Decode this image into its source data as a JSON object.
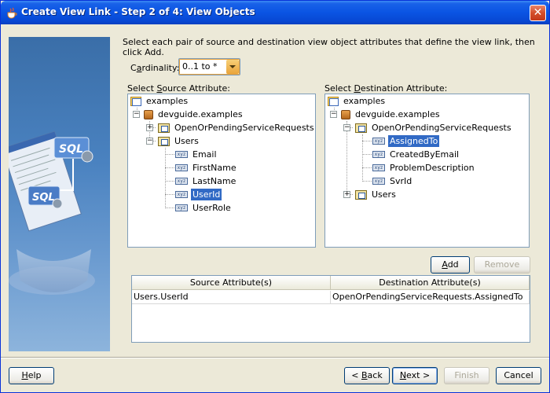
{
  "window": {
    "title": "Create View Link - Step 2 of 4: View Objects",
    "close_glyph": "✕"
  },
  "instructions": "Select each pair of source and destination view object attributes that define the view link, then click Add.",
  "cardinality": {
    "label_pre": "C",
    "label_u": "a",
    "label_post": "rdinality:",
    "value": "0..1 to *"
  },
  "source": {
    "label_pre": "Select ",
    "label_u": "S",
    "label_post": "ource Attribute:",
    "nodes": [
      "examples",
      "devguide.examples",
      "OpenOrPendingServiceRequests",
      "Users",
      "Email",
      "FirstName",
      "LastName",
      "UserId",
      "UserRole"
    ]
  },
  "destination": {
    "label_pre": "Select ",
    "label_u": "D",
    "label_post": "estination Attribute:",
    "nodes": [
      "examples",
      "devguide.examples",
      "OpenOrPendingServiceRequests",
      "AssignedTo",
      "CreatedByEmail",
      "ProblemDescription",
      "SvrId",
      "Users"
    ]
  },
  "buttons": {
    "add_u": "A",
    "add_rest": "dd",
    "remove": "Remove",
    "help_u": "H",
    "help_rest": "elp",
    "back_pre": "< ",
    "back_u": "B",
    "back_rest": "ack",
    "next_u": "N",
    "next_rest": "ext >",
    "finish": "Finish",
    "cancel": "Cancel"
  },
  "table": {
    "headers": [
      "Source Attribute(s)",
      "Destination Attribute(s)"
    ],
    "rows": [
      [
        "Users.UserId",
        "OpenOrPendingServiceRequests.AssignedTo"
      ]
    ]
  },
  "colors": {
    "selection": "#316ac5",
    "title_bar": "#0a54e3"
  }
}
